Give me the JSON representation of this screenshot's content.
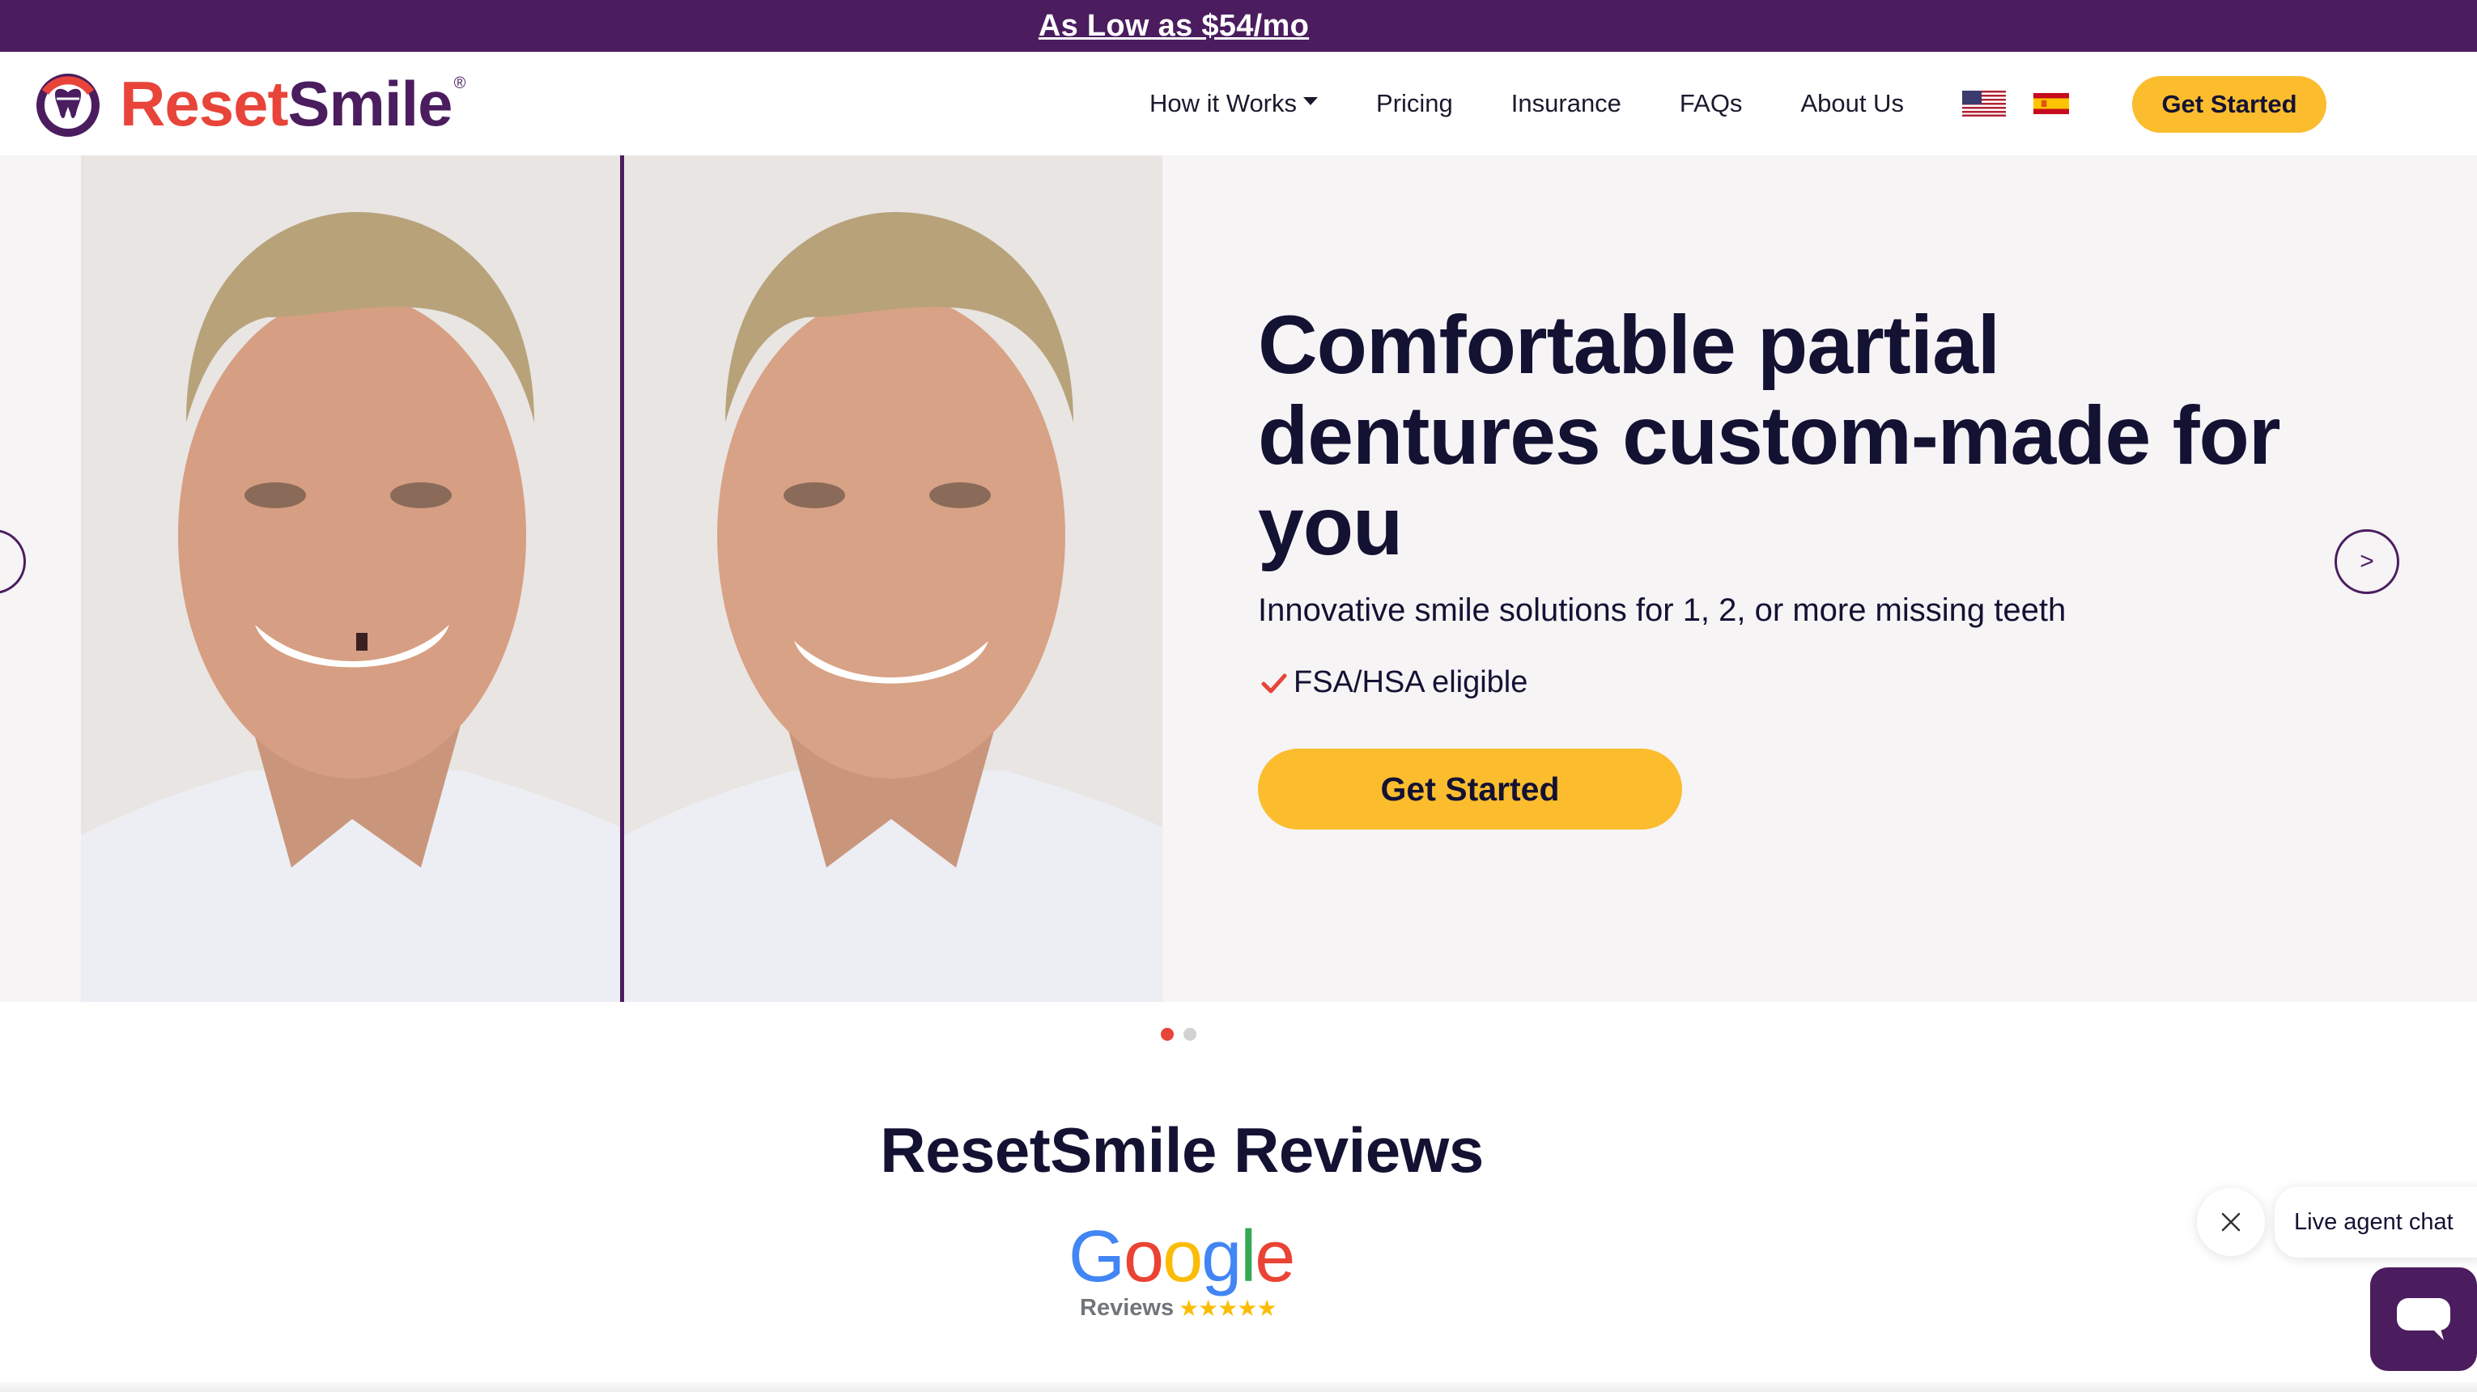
{
  "promo": {
    "text": "As Low as $54/mo"
  },
  "brand": {
    "reset": "Reset",
    "smile": "Smile",
    "reg": "®",
    "primary": "#4b1d5f",
    "accent": "#e8443a",
    "cta": "#fbbd2e"
  },
  "nav": {
    "items": [
      {
        "label": "How it Works",
        "dropdown": true
      },
      {
        "label": "Pricing"
      },
      {
        "label": "Insurance"
      },
      {
        "label": "FAQs"
      },
      {
        "label": "About Us"
      }
    ],
    "flags": [
      "us-flag-icon",
      "spain-flag-icon"
    ],
    "cta": "Get Started"
  },
  "hero": {
    "title": "Comfortable partial dentures custom-made for you",
    "subtitle": "Innovative smile solutions for 1, 2, or more missing teeth",
    "check": "FSA/HSA eligible",
    "cta": "Get Started",
    "prev": "<",
    "next": ">",
    "slide_count": 2,
    "active_slide": 1
  },
  "reviews": {
    "title": "ResetSmile Reviews",
    "google_letters": [
      "G",
      "o",
      "o",
      "g",
      "l",
      "e"
    ],
    "google_sub": "Reviews",
    "stars": "★★★★★"
  },
  "chat": {
    "bubble": "Live agent chat"
  }
}
